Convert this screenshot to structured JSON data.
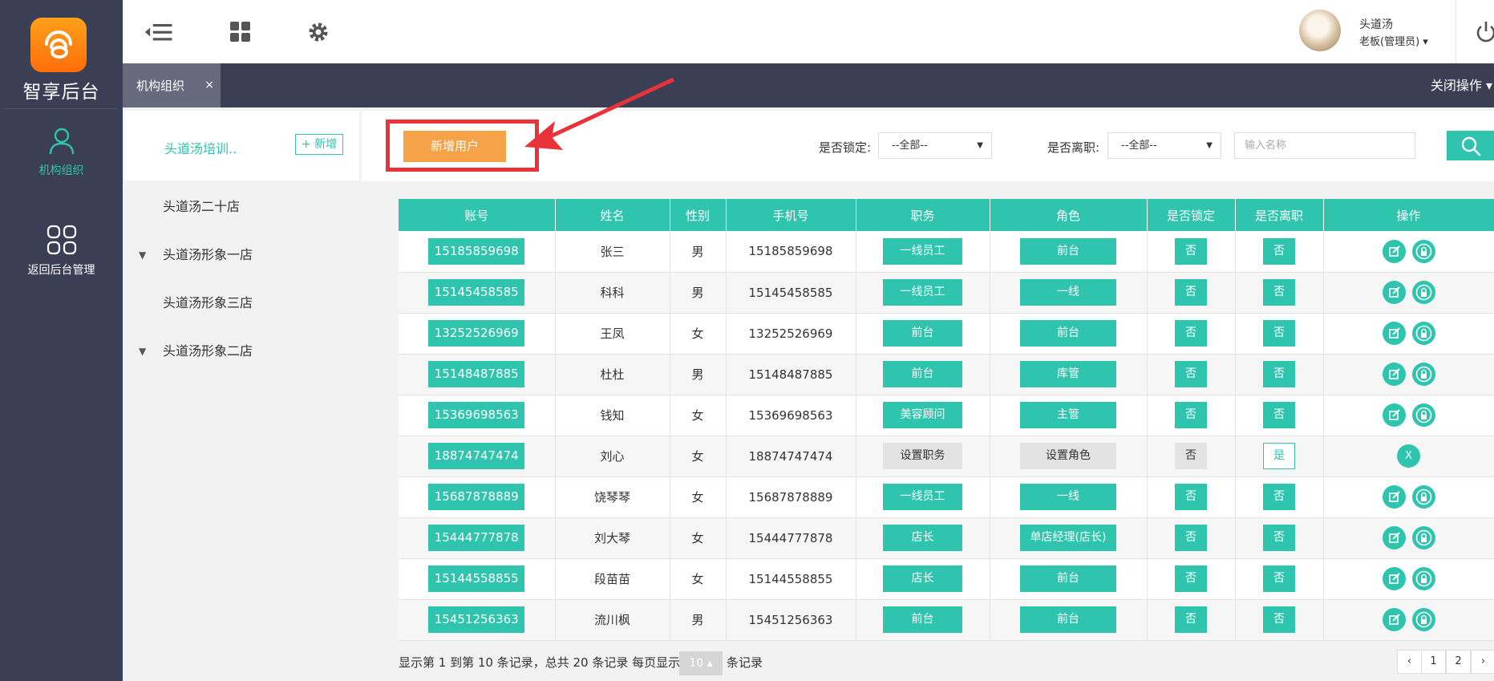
{
  "sidebar": {
    "logo_text": "智享后台",
    "items": [
      {
        "label": "机构组织",
        "icon": "user-icon"
      },
      {
        "label": "返回后台管理",
        "icon": "apps-grid-icon"
      }
    ]
  },
  "header": {
    "icons": [
      "menu-collapse-icon",
      "grid-icon",
      "gear-icon"
    ],
    "user_name": "头道汤",
    "user_role": "老板(管理员) ▾"
  },
  "tabbar": {
    "tab_label": "机构组织",
    "tab_close": "×",
    "close_ops": "关闭操作 ▾"
  },
  "tree": {
    "title": "头道汤培训..",
    "add_label": "+ 新增",
    "nodes": [
      {
        "label": "头道汤二十店",
        "expander": ""
      },
      {
        "label": "头道汤形象一店",
        "expander": "▼"
      },
      {
        "label": "头道汤形象三店",
        "expander": ""
      },
      {
        "label": "头道汤形象二店",
        "expander": "▼"
      }
    ]
  },
  "toolbar": {
    "new_user_label": "新增用户",
    "locked_label": "是否锁定:",
    "locked_value": "--全部--",
    "resigned_label": "是否离职:",
    "resigned_value": "--全部--",
    "search_placeholder": "输入名称",
    "annotation_color": "#e8333b"
  },
  "table": {
    "headers": [
      "账号",
      "姓名",
      "性别",
      "手机号",
      "职务",
      "角色",
      "是否锁定",
      "是否离职",
      "操作"
    ],
    "rows": [
      {
        "account": "15185859698",
        "name": "张三",
        "gender": "男",
        "phone": "15185859698",
        "position": "一线员工",
        "role": "前台",
        "locked": "否",
        "resigned": "否"
      },
      {
        "account": "15145458585",
        "name": "科科",
        "gender": "男",
        "phone": "15145458585",
        "position": "一线员工",
        "role": "一线",
        "locked": "否",
        "resigned": "否"
      },
      {
        "account": "13252526969",
        "name": "王凤",
        "gender": "女",
        "phone": "13252526969",
        "position": "前台",
        "role": "前台",
        "locked": "否",
        "resigned": "否"
      },
      {
        "account": "15148487885",
        "name": "杜杜",
        "gender": "男",
        "phone": "15148487885",
        "position": "前台",
        "role": "库管",
        "locked": "否",
        "resigned": "否"
      },
      {
        "account": "15369698563",
        "name": "钱知",
        "gender": "女",
        "phone": "15369698563",
        "position": "美容顾问",
        "role": "主管",
        "locked": "否",
        "resigned": "否"
      },
      {
        "account": "18874747474",
        "name": "刘心",
        "gender": "女",
        "phone": "18874747474",
        "position": "设置职务",
        "role": "设置角色",
        "locked": "否",
        "resigned": "是",
        "inactive": true,
        "op_label": "X"
      },
      {
        "account": "15687878889",
        "name": "饶琴琴",
        "gender": "女",
        "phone": "15687878889",
        "position": "一线员工",
        "role": "一线",
        "locked": "否",
        "resigned": "否"
      },
      {
        "account": "15444777878",
        "name": "刘大琴",
        "gender": "女",
        "phone": "15444777878",
        "position": "店长",
        "role": "单店经理(店长)",
        "locked": "否",
        "resigned": "否"
      },
      {
        "account": "15144558855",
        "name": "段苗苗",
        "gender": "女",
        "phone": "15144558855",
        "position": "店长",
        "role": "前台",
        "locked": "否",
        "resigned": "否"
      },
      {
        "account": "15451256363",
        "name": "流川枫",
        "gender": "男",
        "phone": "15451256363",
        "position": "前台",
        "role": "前台",
        "locked": "否",
        "resigned": "否"
      }
    ]
  },
  "footer": {
    "summary": "显示第 1 到第 10 条记录，总共 20 条记录 每页显示",
    "page_size": "10 ▴",
    "suffix": "条记录",
    "pager": [
      "‹",
      "1",
      "2",
      "›"
    ]
  },
  "colors": {
    "accent": "#2ec4ad",
    "orange": "#f5a249",
    "sidebar": "#3a3f55"
  }
}
